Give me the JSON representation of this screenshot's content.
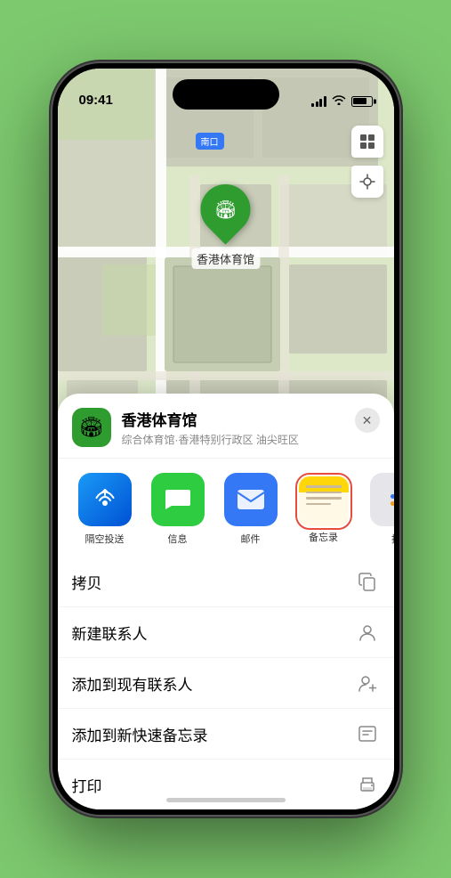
{
  "status_bar": {
    "time": "09:41",
    "location_arrow": "▶"
  },
  "map": {
    "road_label": "南口",
    "pin_label": "香港体育馆"
  },
  "location_header": {
    "name": "香港体育馆",
    "subtitle": "综合体育馆·香港特别行政区 油尖旺区",
    "close_label": "✕"
  },
  "share_apps": [
    {
      "id": "airdrop",
      "label": "隔空投送"
    },
    {
      "id": "messages",
      "label": "信息"
    },
    {
      "id": "mail",
      "label": "邮件"
    },
    {
      "id": "notes",
      "label": "备忘录"
    },
    {
      "id": "more",
      "label": "推"
    }
  ],
  "actions": [
    {
      "id": "copy",
      "label": "拷贝"
    },
    {
      "id": "new-contact",
      "label": "新建联系人"
    },
    {
      "id": "add-existing",
      "label": "添加到现有联系人"
    },
    {
      "id": "quick-note",
      "label": "添加到新快速备忘录"
    },
    {
      "id": "print",
      "label": "打印"
    }
  ]
}
